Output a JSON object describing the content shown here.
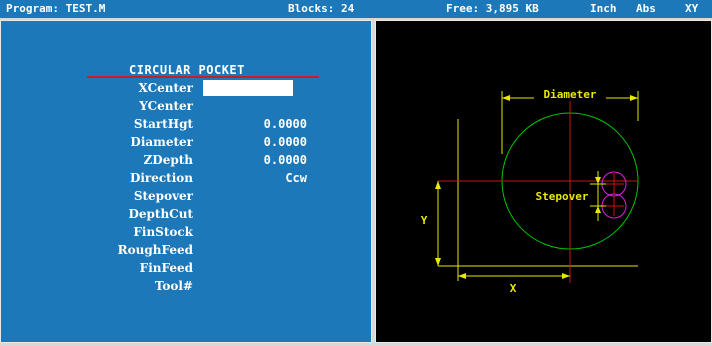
{
  "status_bar": {
    "program": "Program: TEST.M",
    "blocks": "Blocks: 24",
    "free": "Free: 3,895 KB",
    "units": "Inch",
    "mode": "Abs",
    "plane": "XY"
  },
  "form": {
    "title": "CIRCULAR POCKET",
    "fields": [
      {
        "label": "XCenter",
        "value": ""
      },
      {
        "label": "YCenter",
        "value": ""
      },
      {
        "label": "StartHgt",
        "value": "0.0000"
      },
      {
        "label": "Diameter",
        "value": "0.0000"
      },
      {
        "label": "ZDepth",
        "value": "0.0000"
      },
      {
        "label": "Direction",
        "value": "Ccw"
      },
      {
        "label": "Stepover",
        "value": ""
      },
      {
        "label": "DepthCut",
        "value": ""
      },
      {
        "label": "FinStock",
        "value": ""
      },
      {
        "label": "RoughFeed",
        "value": ""
      },
      {
        "label": "FinFeed",
        "value": ""
      },
      {
        "label": "Tool#",
        "value": ""
      }
    ]
  },
  "diagram": {
    "diameter_label": "Diameter",
    "stepover_label": "Stepover",
    "x_label": "X",
    "y_label": "Y",
    "colors": {
      "dimension": "#e8e800",
      "circle": "#00c800",
      "center_lines": "#d01010",
      "tool": "#e020e0"
    }
  }
}
